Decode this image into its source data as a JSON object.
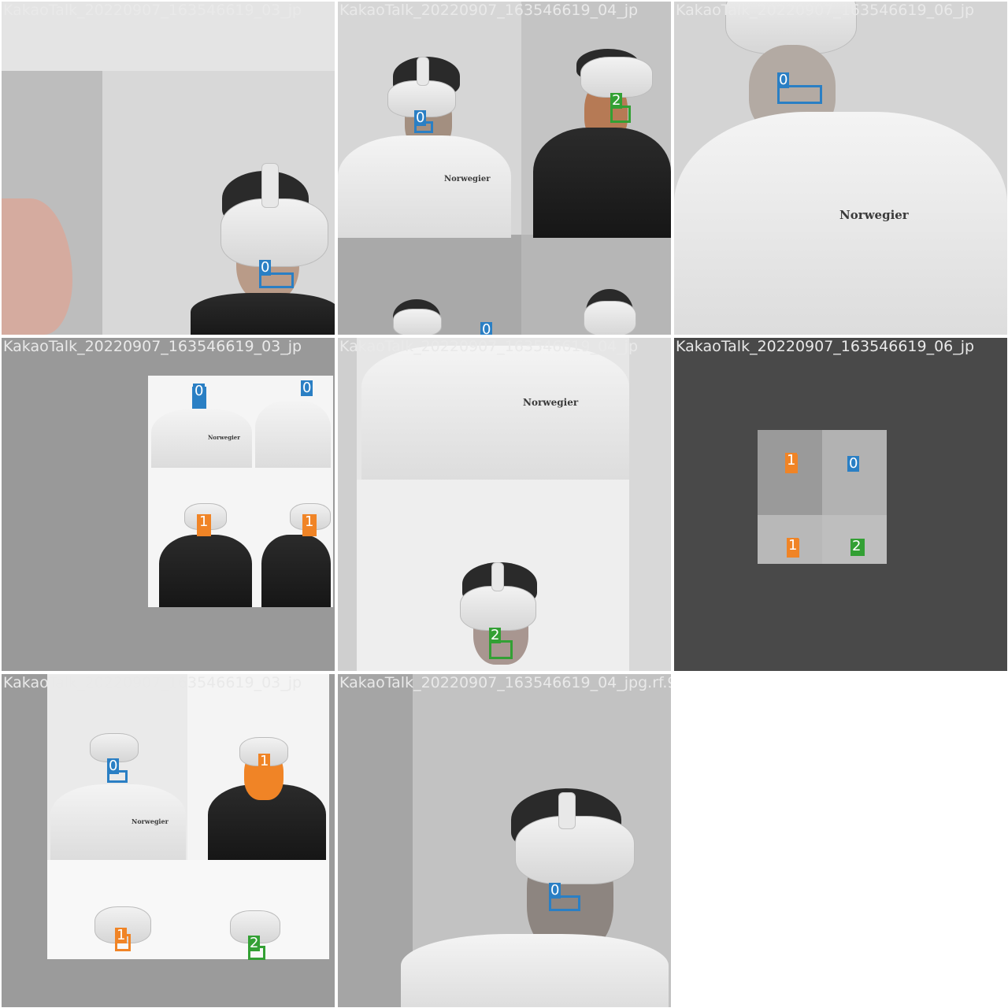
{
  "tiles": [
    "KakaoTalk_20220907_163546619_03_jp",
    "KakaoTalk_20220907_163546619_04_jp",
    "KakaoTalk_20220907_163546619_06_jp",
    "KakaoTalk_20220907_163546619_03_jp",
    "KakaoTalk_20220907_163546619_04_jp",
    "KakaoTalk_20220907_163546619_06_jp",
    "KakaoTalk_20220907_163546619_03_jp",
    "KakaoTalk_20220907_163546619_04_jpg.rf.9"
  ],
  "class_colors": {
    "0": "#2a7fc4",
    "1": "#f08426",
    "2": "#33a034"
  },
  "labels": {
    "zero": "0",
    "one": "1",
    "two": "2"
  },
  "shirt_text": "Norwegier"
}
